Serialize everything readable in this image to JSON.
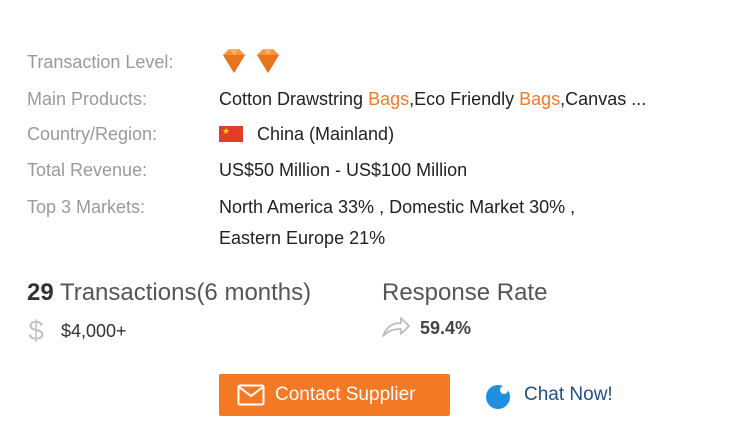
{
  "rows": {
    "transaction_level": {
      "label": "Transaction Level:"
    },
    "main_products": {
      "label": "Main Products:",
      "p1": "Cotton Drawstring ",
      "p1_hl": "Bags",
      "p2": ",Eco Friendly ",
      "p2_hl": "Bags",
      "p3": ",Canvas ..."
    },
    "country": {
      "label": "Country/Region:",
      "value": "China (Mainland)"
    },
    "revenue": {
      "label": "Total Revenue:",
      "value": "US$50 Million - US$100 Million"
    },
    "markets": {
      "label": "Top 3 Markets:",
      "line1": "North America 33% , Domestic Market 30% ,",
      "line2": "Eastern Europe 21%"
    }
  },
  "stats": {
    "transactions_count": "29",
    "transactions_label": " Transactions(6 months)",
    "transactions_amount": "$4,000+",
    "response_label": "Response Rate",
    "response_value": "59.4%"
  },
  "actions": {
    "contact_label": "Contact Supplier",
    "chat_label": "Chat Now!"
  },
  "colors": {
    "accent": "#f47925",
    "link": "#1f4f8a"
  },
  "icons": [
    "diamond-icon",
    "china-flag-icon",
    "dollar-icon",
    "share-arrow-icon",
    "mail-icon",
    "chat-bubble-icon"
  ]
}
